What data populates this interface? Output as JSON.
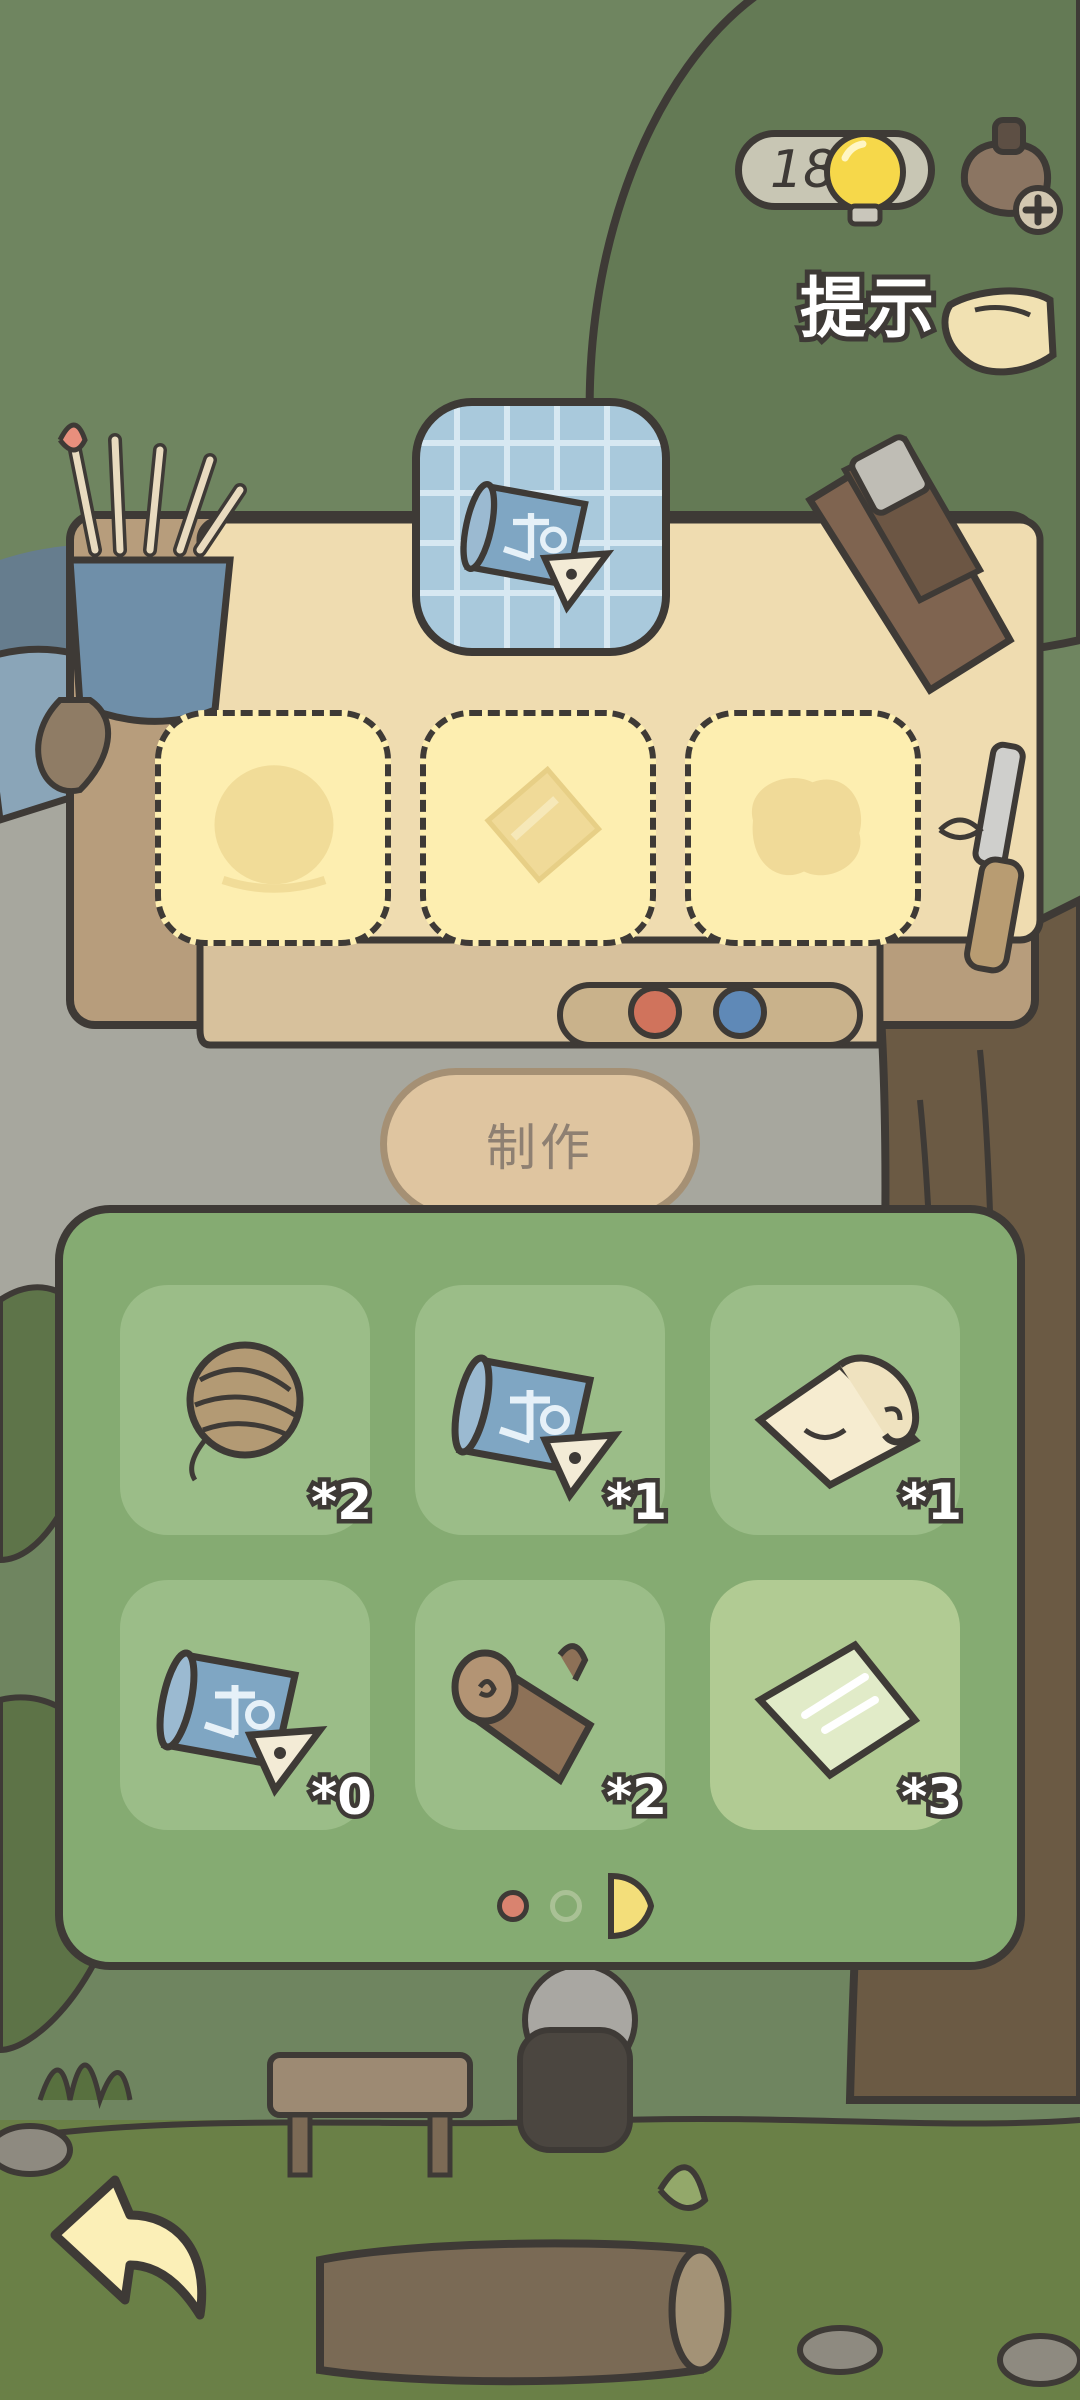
{
  "hint": {
    "count": "18",
    "label": "提示"
  },
  "craft": {
    "target_icon": "blueprint-icon",
    "slots": [
      {
        "icon": "yarn-ball-icon",
        "state": "empty"
      },
      {
        "icon": "glass-pane-icon",
        "state": "empty"
      },
      {
        "icon": "lump-icon",
        "state": "empty"
      }
    ],
    "make_label": "制作"
  },
  "inventory": {
    "items": [
      {
        "icon": "yarn-ball-icon",
        "qty": "*2"
      },
      {
        "icon": "blueprint-icon",
        "qty": "*1"
      },
      {
        "icon": "paper-roll-icon",
        "qty": "*1"
      },
      {
        "icon": "blueprint-icon",
        "qty": "*0"
      },
      {
        "icon": "wood-log-icon",
        "qty": "*2"
      },
      {
        "icon": "glass-pane-icon",
        "qty": "*3"
      }
    ],
    "page_dots": [
      "active",
      "inactive",
      "half"
    ]
  },
  "colors": {
    "outline": "#3e3a36",
    "panel": "#85ab72",
    "slot": "#fdeeb0",
    "accent": "#f3de7a"
  }
}
